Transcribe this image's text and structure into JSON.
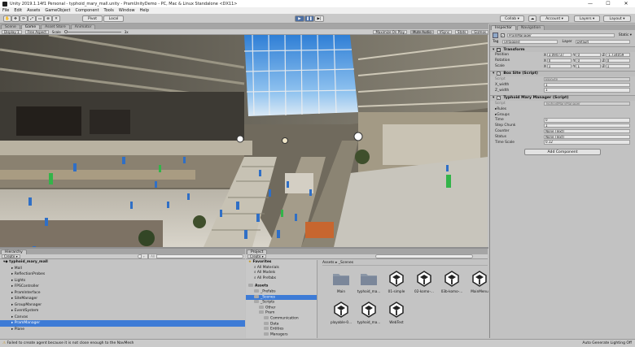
{
  "window": {
    "title": "Unity 2019.1.14f1 Personal - typhoid_mary_mall.unity - PramUnityDemo - PC, Mac & Linux Standalone <DX11>",
    "controls": [
      "—",
      "☐",
      "✕"
    ]
  },
  "menu": [
    "File",
    "Edit",
    "Assets",
    "GameObject",
    "Component",
    "Tools",
    "Window",
    "Help"
  ],
  "toolbar": {
    "pivot_label": "Pivot",
    "local_label": "Local",
    "collab_label": "Collab ▾",
    "account_label": "Account ▾",
    "layers_label": "Layers ▾",
    "layout_label": "Layout ▾"
  },
  "game_panel": {
    "tabs": [
      "Scene",
      "Game",
      "Asset Store",
      "Animator"
    ],
    "display": "Display 1",
    "aspect": "Free Aspect",
    "scale_label": "Scale",
    "scale_value": "3x",
    "options": [
      "Maximize On Play",
      "Mute Audio",
      "VSync",
      "Stats",
      "Gizmos"
    ]
  },
  "hierarchy": {
    "tab": "Hierarchy",
    "create_label": "Create ▾",
    "search_placeholder": "All",
    "root": "typhoid_mary_mall",
    "items": [
      "Mall",
      "ReflectionProbes",
      "Lights",
      "FPSController",
      "PramInterface",
      "SiteManager",
      "GroupManager",
      "EventSystem",
      "Canvas",
      "PramManager",
      "Plane"
    ],
    "selected_index": 9
  },
  "project": {
    "tab": "Project",
    "create_label": "Create ▾",
    "favorites_label": "Favorites",
    "favorites": [
      "All Materials",
      "All Models",
      "All Prefabs"
    ],
    "assets_label": "Assets",
    "tree": [
      "_Prefabs",
      "_Scenes",
      "_Scripts",
      "Other",
      "Pram",
      "Communication",
      "Data",
      "Entities",
      "Managers"
    ],
    "selected_tree_index": 1,
    "breadcrumb": "Assets ▸ _Scenes",
    "files": [
      {
        "name": "Main",
        "kind": "folder"
      },
      {
        "name": "typhoid_ma...",
        "kind": "folder"
      },
      {
        "name": "01-simple",
        "kind": "unity"
      },
      {
        "name": "02-komo-...",
        "kind": "unity"
      },
      {
        "name": "03b-komo-...",
        "kind": "unity"
      },
      {
        "name": "MainMenu",
        "kind": "unity"
      },
      {
        "name": "playable-0...",
        "kind": "unity"
      },
      {
        "name": "typhoid_ma...",
        "kind": "unity"
      },
      {
        "name": "WebTest",
        "kind": "unity"
      }
    ]
  },
  "status": {
    "message": "Failed to create agent because it is not close enough to the NavMesh",
    "right": "Auto Generate Lighting Off"
  },
  "inspector": {
    "tabs": [
      "Inspector",
      "Navigation"
    ],
    "object_name": "PramManager",
    "static_label": "Static ▾",
    "tag_label": "Tag",
    "tag_value": "Untagged",
    "layer_label": "Layer",
    "layer_value": "Default",
    "transform": {
      "title": "Transform",
      "position_label": "Position",
      "position": [
        "3.094737",
        "0",
        "-1.734059"
      ],
      "rotation_label": "Rotation",
      "rotation": [
        "0",
        "0",
        "0"
      ],
      "scale_label": "Scale",
      "scale": [
        "1",
        "1",
        "1"
      ]
    },
    "box_site": {
      "title": "Box Site (Script)",
      "script_label": "Script",
      "script_value": "BoxSite",
      "x_label": "X_width",
      "x_value": "1",
      "z_label": "Z_width",
      "z_value": "1"
    },
    "typhoid": {
      "title": "Typhoid Mary Manager (Script)",
      "script_label": "Script",
      "script_value": "TyphoidMaryManager",
      "fields": [
        {
          "label": "Rules",
          "value": "",
          "foldout": true
        },
        {
          "label": "Groups",
          "value": "",
          "foldout": true
        },
        {
          "label": "Time",
          "value": "0"
        },
        {
          "label": "Step Chunk",
          "value": "1"
        },
        {
          "label": "Counter",
          "value": "None (Text)"
        },
        {
          "label": "Status",
          "value": "None (Text)"
        },
        {
          "label": "Time Scale",
          "value": "0.12"
        }
      ]
    },
    "add_component_label": "Add Component"
  }
}
